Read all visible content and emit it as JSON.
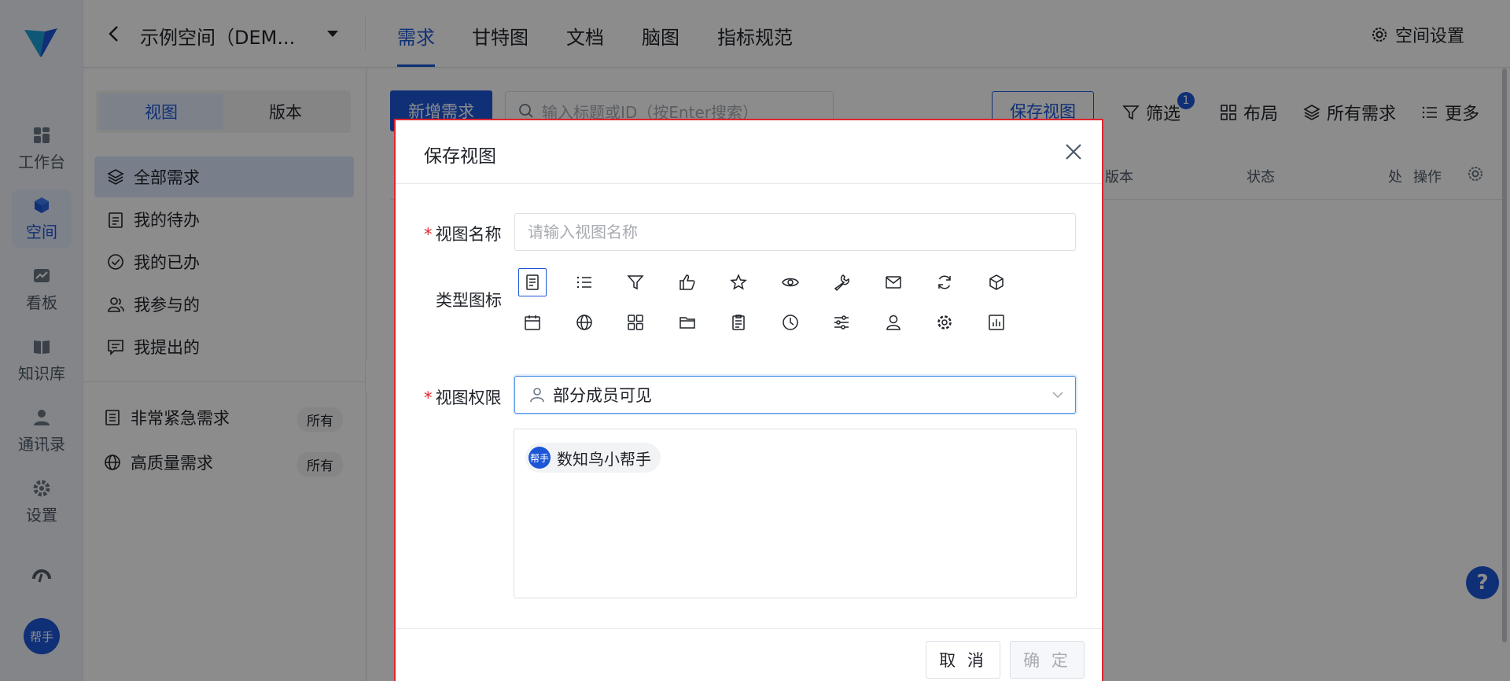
{
  "rail": {
    "items": [
      {
        "label": "工作台",
        "icon": "dashboard-icon"
      },
      {
        "label": "空间",
        "icon": "cube-icon"
      },
      {
        "label": "看板",
        "icon": "chart-board-icon"
      },
      {
        "label": "知识库",
        "icon": "book-icon"
      },
      {
        "label": "通讯录",
        "icon": "contacts-icon"
      },
      {
        "label": "设置",
        "icon": "gear-icon"
      }
    ],
    "avatar_text": "帮手"
  },
  "topbar": {
    "space_name": "示例空间（DEM...",
    "tabs": [
      "需求",
      "甘特图",
      "文档",
      "脑图",
      "指标规范"
    ],
    "settings_label": "空间设置"
  },
  "sidebar": {
    "segment": [
      "视图",
      "版本"
    ],
    "nav": [
      "全部需求",
      "我的待办",
      "我的已办",
      "我参与的",
      "我提出的"
    ],
    "views": [
      {
        "label": "非常紧急需求",
        "badge": "所有"
      },
      {
        "label": "高质量需求",
        "badge": "所有"
      }
    ]
  },
  "main": {
    "new_button": "新增需求",
    "search_placeholder": "输入标题或ID（按Enter搜索）",
    "save_view_button": "保存视图",
    "tools": {
      "filter": "筛选",
      "filter_count": "1",
      "layout": "布局",
      "all": "所有需求",
      "more": "更多"
    },
    "columns": [
      "版本",
      "状态",
      "处",
      "操作"
    ]
  },
  "modal": {
    "title": "保存视图",
    "name_label": "视图名称",
    "name_placeholder": "请输入视图名称",
    "icon_label": "类型图标",
    "icons": [
      "receipt-icon",
      "list-icon",
      "filter-icon",
      "thumb-up-icon",
      "star-icon",
      "eye-icon",
      "wrench-icon",
      "mail-icon",
      "refresh-icon",
      "box-icon",
      "calendar-icon",
      "globe-icon",
      "grid-icon",
      "folder-icon",
      "clipboard-icon",
      "clock-icon",
      "sliders-icon",
      "user-icon",
      "settings-icon",
      "bar-chart-icon"
    ],
    "selected_icon": "receipt-icon",
    "perm_label": "视图权限",
    "perm_value": "部分成员可见",
    "members": [
      {
        "avatar": "帮手",
        "name": "数知鸟小帮手"
      }
    ],
    "cancel_label": "取 消",
    "ok_label": "确 定"
  },
  "help_label": "?"
}
